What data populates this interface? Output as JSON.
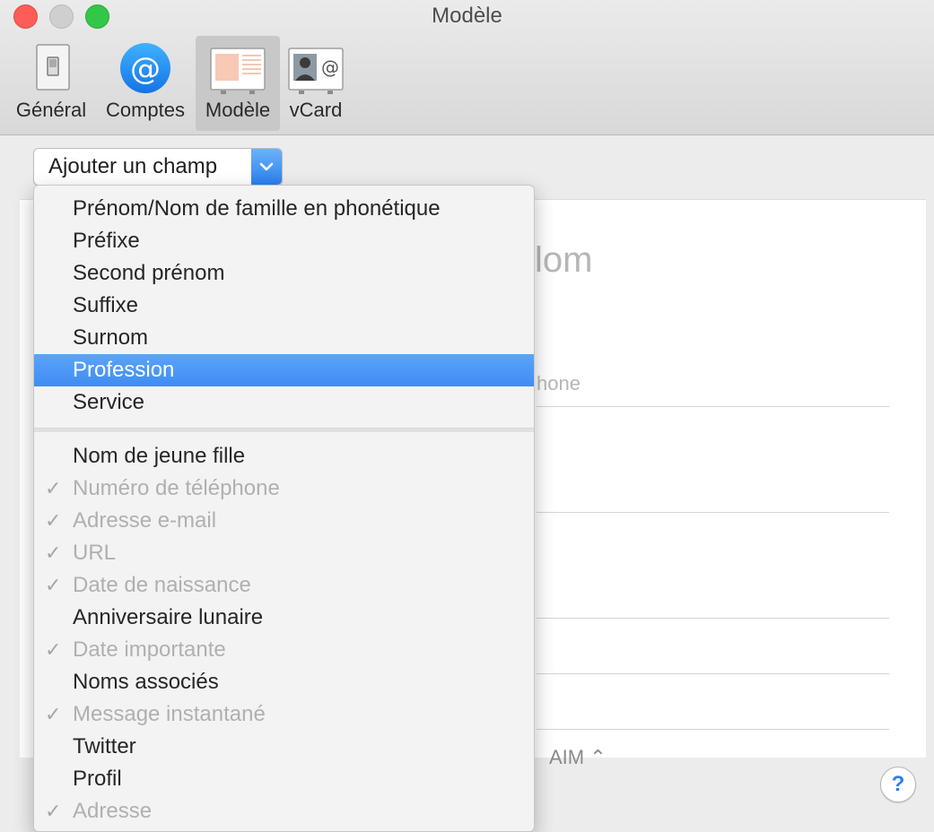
{
  "window": {
    "title": "Modèle"
  },
  "toolbar": {
    "items": [
      {
        "label": "Général",
        "icon": "switch-icon"
      },
      {
        "label": "Comptes",
        "icon": "at-icon"
      },
      {
        "label": "Modèle",
        "icon": "template-card-icon",
        "selected": true
      },
      {
        "label": "vCard",
        "icon": "vcard-icon"
      }
    ]
  },
  "add_field": {
    "label": "Ajouter un champ"
  },
  "background": {
    "name_partial": "lom",
    "phone_partial": "hone",
    "aim_partial": "AIM ⌃"
  },
  "menu": {
    "items": [
      {
        "label": "Prénom/Nom de famille en phonétique",
        "checked": false,
        "enabled": true
      },
      {
        "label": "Préfixe",
        "checked": false,
        "enabled": true
      },
      {
        "label": "Second prénom",
        "checked": false,
        "enabled": true
      },
      {
        "label": "Suffixe",
        "checked": false,
        "enabled": true
      },
      {
        "label": "Surnom",
        "checked": false,
        "enabled": true
      },
      {
        "label": "Profession",
        "checked": false,
        "enabled": true,
        "highlighted": true
      },
      {
        "label": "Service",
        "checked": false,
        "enabled": true
      },
      {
        "label": "Nom de jeune fille",
        "checked": false,
        "enabled": true
      },
      {
        "label": "Numéro de téléphone",
        "checked": true,
        "enabled": false
      },
      {
        "label": "Adresse e-mail",
        "checked": true,
        "enabled": false
      },
      {
        "label": "URL",
        "checked": true,
        "enabled": false
      },
      {
        "label": "Date de naissance",
        "checked": true,
        "enabled": false
      },
      {
        "label": "Anniversaire lunaire",
        "checked": false,
        "enabled": true
      },
      {
        "label": "Date importante",
        "checked": true,
        "enabled": false
      },
      {
        "label": "Noms associés",
        "checked": false,
        "enabled": true
      },
      {
        "label": "Message instantané",
        "checked": true,
        "enabled": false
      },
      {
        "label": "Twitter",
        "checked": false,
        "enabled": true
      },
      {
        "label": "Profil",
        "checked": false,
        "enabled": true
      },
      {
        "label": "Adresse",
        "checked": true,
        "enabled": false
      }
    ],
    "checkmark": "✓"
  },
  "help": {
    "label": "?"
  },
  "colors": {
    "highlight": "#3f8cf4",
    "close": "#fc5d57",
    "zoom": "#33c748",
    "help_accent": "#2f7bf5"
  }
}
